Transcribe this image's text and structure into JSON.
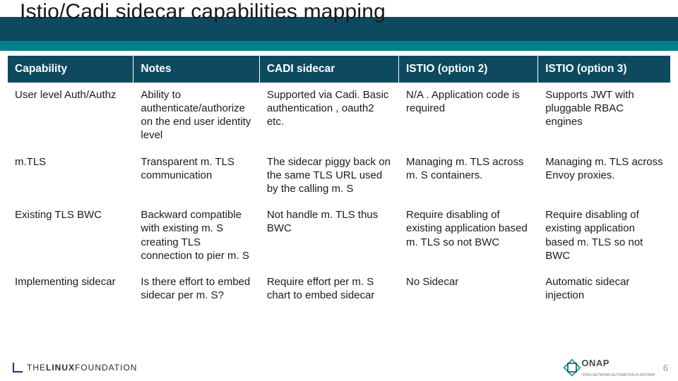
{
  "title": "Istio/Cadi sidecar capabilities mapping",
  "table": {
    "headers": [
      "Capability",
      "Notes",
      "CADI sidecar",
      "ISTIO (option 2)",
      "ISTIO (option 3)"
    ],
    "rows": [
      {
        "capability": "User level Auth/Authz",
        "notes": "Ability to authenticate/authorize on the end user identity level",
        "cadi": "Supported via Cadi. Basic authentication , oauth2 etc.",
        "opt2": "N/A . Application code is required",
        "opt3": "Supports JWT with pluggable RBAC engines"
      },
      {
        "capability": "m.TLS",
        "notes": "Transparent m. TLS communication",
        "cadi": "The sidecar piggy back on the same TLS URL used by the calling m. S",
        "opt2": "Managing m. TLS across m. S containers.",
        "opt3": " Managing m. TLS across Envoy proxies."
      },
      {
        "capability": "Existing TLS BWC",
        "notes": "Backward compatible with existing m. S creating TLS connection to pier m. S",
        "cadi": "Not handle m. TLS thus BWC",
        "opt2": "Require disabling of existing application based m. TLS so not BWC",
        "opt3": "Require disabling of existing application based m. TLS so not BWC"
      },
      {
        "capability": "Implementing sidecar",
        "notes": "Is there effort to embed sidecar per m. S?",
        "cadi": "Require effort per m. S chart to embed sidecar",
        "opt2": "No Sidecar",
        "opt3": "Automatic sidecar injection"
      }
    ]
  },
  "footer": {
    "lf_prefix": "THE",
    "lf_main": "LINUX",
    "lf_suffix": "FOUNDATION",
    "onap": "ONAP",
    "onap_sub": "OPEN NETWORK AUTOMATION PLATFORM",
    "page": "6"
  }
}
